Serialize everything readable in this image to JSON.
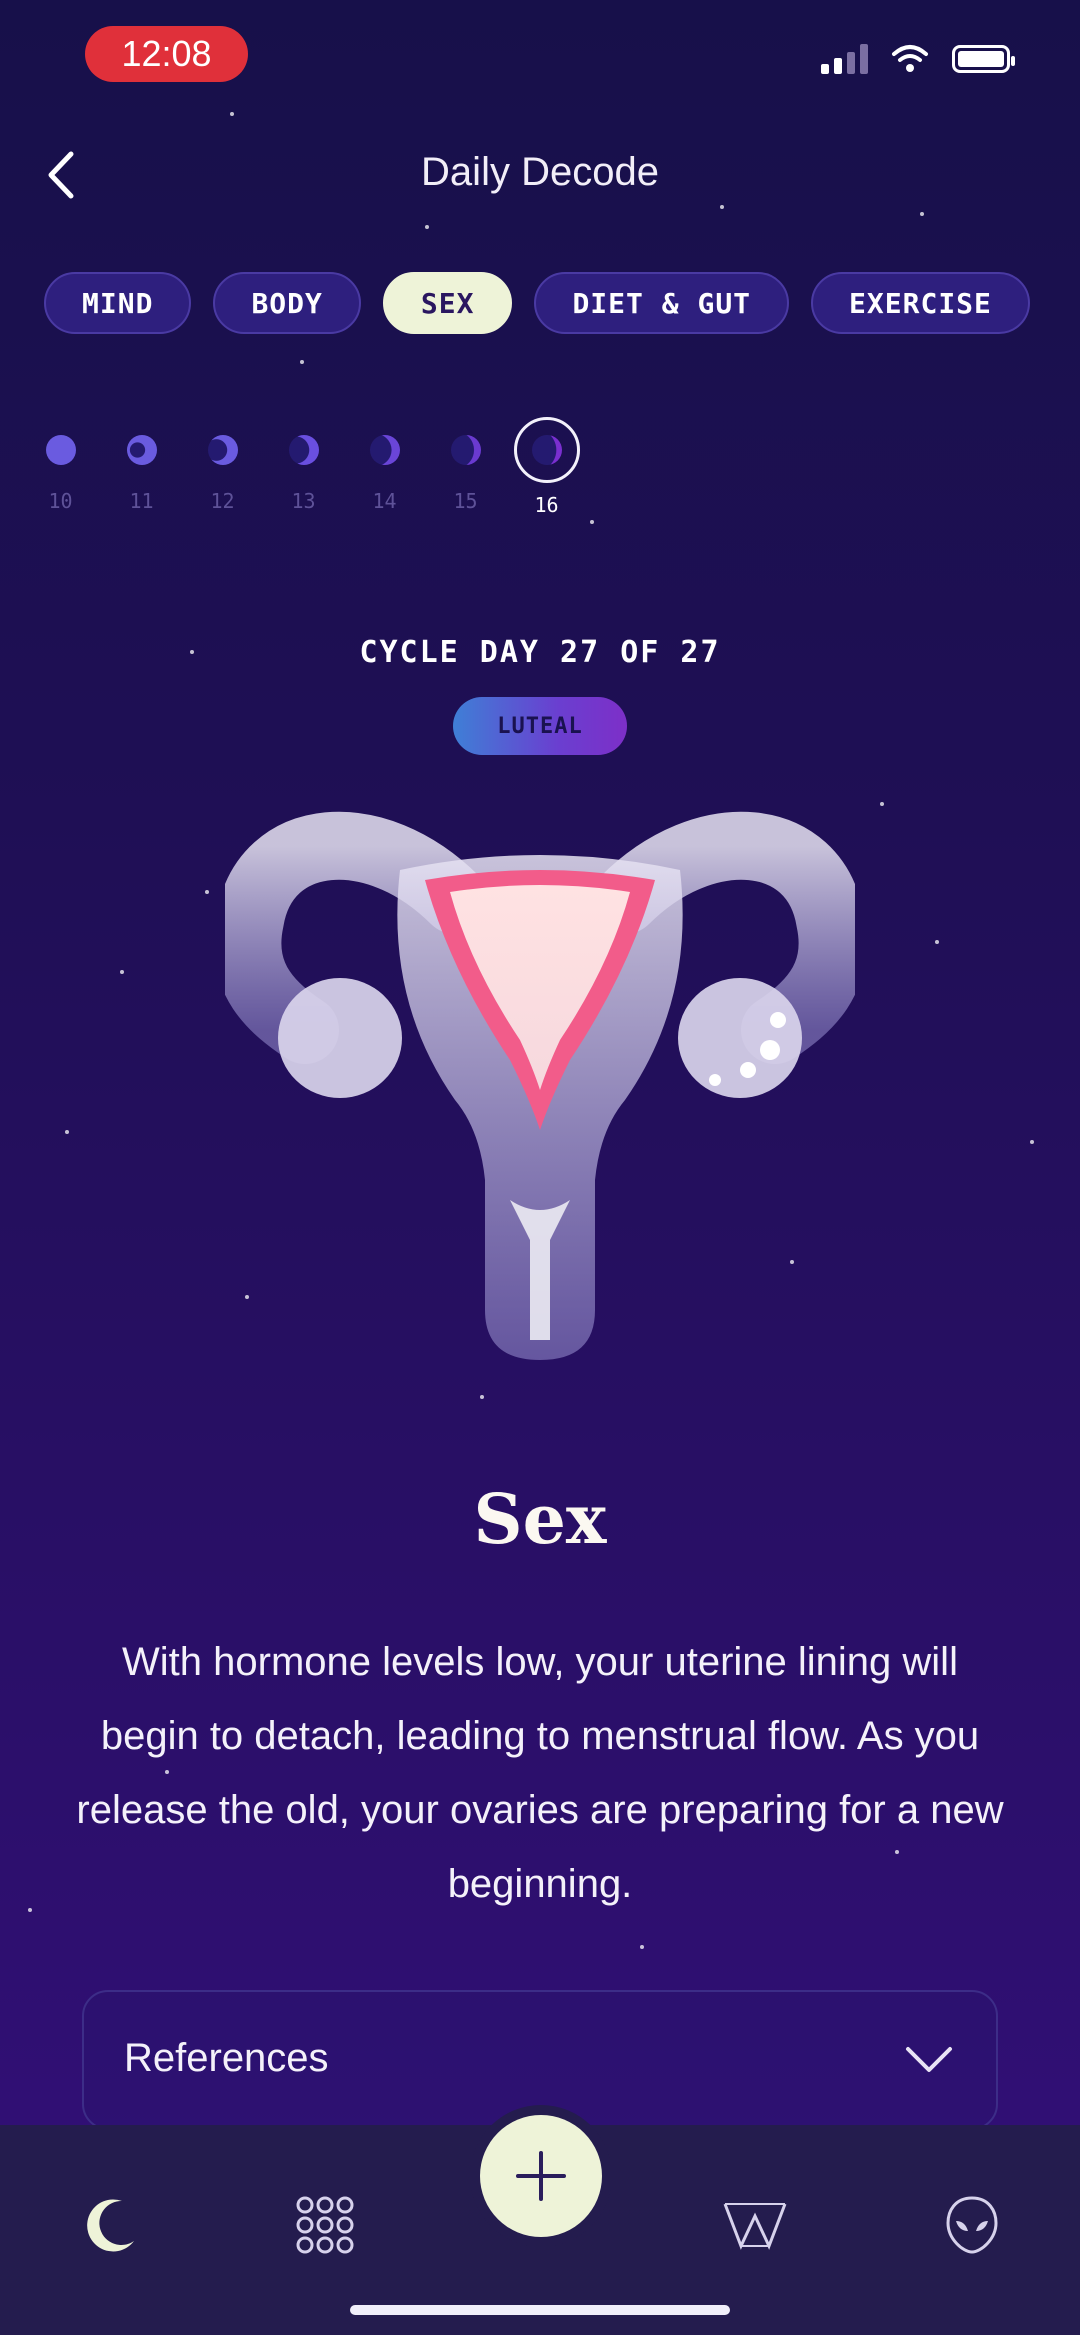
{
  "status_bar": {
    "time": "12:08"
  },
  "header": {
    "title": "Daily Decode",
    "back_icon": "chevron-left-icon"
  },
  "tabs": [
    {
      "label": "MIND",
      "active": false
    },
    {
      "label": "BODY",
      "active": false
    },
    {
      "label": "SEX",
      "active": true
    },
    {
      "label": "DIET & GUT",
      "active": false
    },
    {
      "label": "EXERCISE",
      "active": false
    }
  ],
  "days": [
    {
      "num": "10"
    },
    {
      "num": "11"
    },
    {
      "num": "12"
    },
    {
      "num": "13"
    },
    {
      "num": "14"
    },
    {
      "num": "15"
    },
    {
      "num": "16",
      "active": true
    }
  ],
  "cycle": {
    "day_text": "CYCLE DAY 27 OF 27",
    "phase": "LUTEAL"
  },
  "content": {
    "title": "Sex",
    "description": "With hormone levels low, your uterine lining will begin to detach, leading to menstrual flow. As you release the old, your ovaries are preparing for a new beginning."
  },
  "references": {
    "label": "References",
    "icon": "chevron-down-icon"
  },
  "bottom_nav": [
    {
      "name": "moon-icon"
    },
    {
      "name": "grid-dots-icon"
    },
    {
      "name": "plus-icon"
    },
    {
      "name": "wings-logo-icon"
    },
    {
      "name": "alien-icon"
    }
  ],
  "colors": {
    "background_top": "#17104a",
    "background_bottom": "#330f7a",
    "tab_bg": "#2e1f7e",
    "tab_active_bg": "#eef3d8",
    "accent_cream": "#eef3d8",
    "status_time_bg": "#e0303a"
  }
}
